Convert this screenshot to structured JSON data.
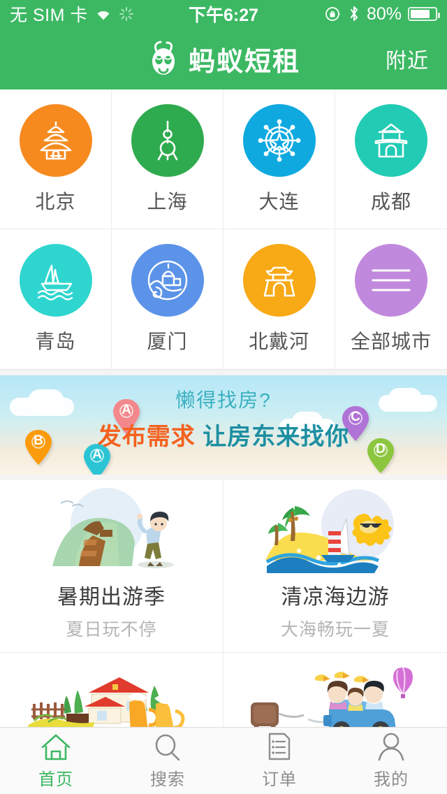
{
  "status_bar": {
    "carrier": "无 SIM 卡",
    "wifi_icon": "wifi-icon",
    "activity_icon": "activity-spinner-icon",
    "time": "下午6:27",
    "rotation_lock_icon": "rotation-lock-icon",
    "bluetooth_icon": "bluetooth-icon",
    "battery_percent": "80%",
    "battery_level": 80
  },
  "header": {
    "logo_icon": "ant-logo-icon",
    "brand": "蚂蚁短租",
    "nearby": "附近",
    "background_color": "#3cb863"
  },
  "cities": [
    {
      "label": "北京",
      "icon": "temple-of-heaven-icon",
      "color": "#f68a1f"
    },
    {
      "label": "上海",
      "icon": "oriental-pearl-tower-icon",
      "color": "#2fab4f"
    },
    {
      "label": "大连",
      "icon": "ship-wheel-star-icon",
      "color": "#0fa9e0"
    },
    {
      "label": "成都",
      "icon": "pagoda-gate-icon",
      "color": "#22cbb4"
    },
    {
      "label": "青岛",
      "icon": "sailboat-waves-icon",
      "color": "#2fd6cf"
    },
    {
      "label": "厦门",
      "icon": "seaside-building-icon",
      "color": "#5b93e8"
    },
    {
      "label": "北戴河",
      "icon": "shanhaiguan-gate-icon",
      "color": "#f8a916"
    },
    {
      "label": "全部城市",
      "icon": "all-cities-menu-icon",
      "color": "#c189dd"
    }
  ],
  "promo": {
    "subtitle": "懒得找房?",
    "title_highlight": "发布需求",
    "title_rest": "让房东来找你",
    "highlight_color": "#f4621f",
    "rest_color": "#1d8fa2",
    "pins": [
      {
        "label": "A",
        "color": "#f2888c"
      },
      {
        "label": "B",
        "color": "#fb9b0c"
      },
      {
        "label": "A",
        "color": "#2bc4d4"
      },
      {
        "label": "C",
        "color": "#b073d6"
      },
      {
        "label": "D",
        "color": "#8cc63e"
      }
    ]
  },
  "theme_cards": [
    {
      "title": "暑期出游季",
      "subtitle": "夏日玩不停",
      "art": "great-wall-traveler-art"
    },
    {
      "title": "清凉海边游",
      "subtitle": "大海畅玩一夏",
      "art": "beach-sailboat-art"
    },
    {
      "title": "",
      "subtitle": "",
      "art": "villa-beer-art"
    },
    {
      "title": "",
      "subtitle": "",
      "art": "family-road-trip-art"
    }
  ],
  "tabs": [
    {
      "label": "首页",
      "icon": "home-icon",
      "active": true
    },
    {
      "label": "搜索",
      "icon": "search-icon",
      "active": false
    },
    {
      "label": "订单",
      "icon": "order-list-icon",
      "active": false
    },
    {
      "label": "我的",
      "icon": "profile-person-icon",
      "active": false
    }
  ]
}
